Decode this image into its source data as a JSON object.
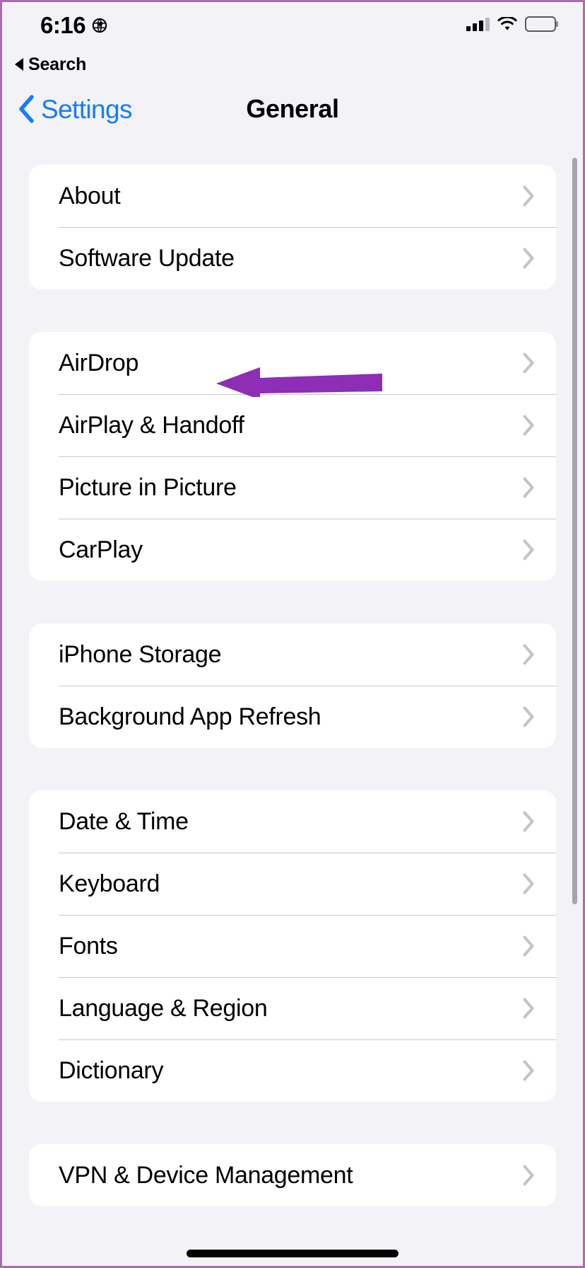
{
  "status_bar": {
    "time": "6:16",
    "location_icon": "location-services-icon",
    "cellular_icon": "cellular-signal-icon",
    "cellular_bars_filled": 3,
    "cellular_bars_total": 4,
    "wifi_icon": "wifi-icon",
    "battery_icon": "battery-full-icon"
  },
  "return_to_app": {
    "icon": "back-triangle-icon",
    "label": "Search"
  },
  "nav_bar": {
    "back_icon": "chevron-left-icon",
    "back_label": "Settings",
    "title": "General"
  },
  "groups": [
    {
      "rows": [
        {
          "label": "About",
          "chevron": "chevron-right-icon"
        },
        {
          "label": "Software Update",
          "chevron": "chevron-right-icon"
        }
      ]
    },
    {
      "rows": [
        {
          "label": "AirDrop",
          "chevron": "chevron-right-icon"
        },
        {
          "label": "AirPlay & Handoff",
          "chevron": "chevron-right-icon"
        },
        {
          "label": "Picture in Picture",
          "chevron": "chevron-right-icon"
        },
        {
          "label": "CarPlay",
          "chevron": "chevron-right-icon"
        }
      ]
    },
    {
      "rows": [
        {
          "label": "iPhone Storage",
          "chevron": "chevron-right-icon"
        },
        {
          "label": "Background App Refresh",
          "chevron": "chevron-right-icon"
        }
      ]
    },
    {
      "rows": [
        {
          "label": "Date & Time",
          "chevron": "chevron-right-icon"
        },
        {
          "label": "Keyboard",
          "chevron": "chevron-right-icon"
        },
        {
          "label": "Fonts",
          "chevron": "chevron-right-icon"
        },
        {
          "label": "Language & Region",
          "chevron": "chevron-right-icon"
        },
        {
          "label": "Dictionary",
          "chevron": "chevron-right-icon"
        }
      ]
    },
    {
      "rows": [
        {
          "label": "VPN & Device Management",
          "chevron": "chevron-right-icon"
        }
      ]
    }
  ],
  "annotation": {
    "type": "arrow-left",
    "points_at": "Software Update",
    "color": "#8e2db5"
  },
  "colors": {
    "accent_blue": "#147efb",
    "page_background": "#f2f2f7",
    "card_background": "#ffffff",
    "separator": "#c8c7cc",
    "chevron_gray": "#c4c4c8",
    "annotation_purple": "#8e2db5",
    "page_border": "#b06ab0"
  },
  "scrollbar": {
    "name": "vertical-scrollbar"
  },
  "home_indicator": {
    "name": "home-indicator"
  }
}
